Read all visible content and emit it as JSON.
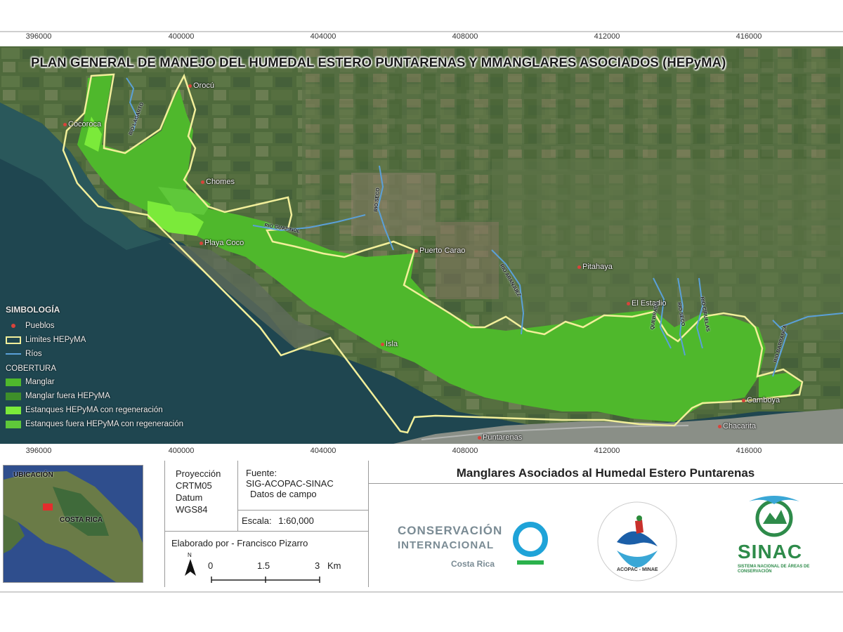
{
  "title": "PLAN GENERAL DE MANEJO DEL HUMEDAL ESTERO PUNTARENAS Y MMANGLARES ASOCIADOS (HEPyMA)",
  "coordinates": {
    "top": [
      "396000",
      "400000",
      "404000",
      "408000",
      "412000",
      "416000"
    ],
    "bottom": [
      "396000",
      "400000",
      "404000",
      "408000",
      "412000",
      "416000"
    ]
  },
  "places": [
    {
      "name": "Orocú"
    },
    {
      "name": "Cocoroca"
    },
    {
      "name": "Chomes"
    },
    {
      "name": "Playa Coco"
    },
    {
      "name": "Puerto Carao"
    },
    {
      "name": "Pitahaya"
    },
    {
      "name": "El Estadio"
    },
    {
      "name": "Isla"
    },
    {
      "name": "Camboya"
    },
    {
      "name": "Chacarita"
    },
    {
      "name": "Puntarenas"
    }
  ],
  "rivers": [
    "RIO LAGARTO",
    "RIO GUAPINOL",
    "RIO SECO",
    "RIO ARANJUEZ",
    "QUEBRADA",
    "RIO SECO",
    "RIO CIRUELAS",
    "RIO BARRANCA"
  ],
  "legend": {
    "title": "SIMBOLOGÍA",
    "items": [
      {
        "label": "Pueblos",
        "icon": "town-dot-icon",
        "color": "#d9433b"
      },
      {
        "label": "Limites HEPyMA",
        "icon": "boundary-line-icon",
        "color": "#f2ef9a"
      },
      {
        "label": "Ríos",
        "icon": "river-line-icon",
        "color": "#5aa0d8"
      }
    ],
    "cover_title": "COBERTURA",
    "cover_items": [
      {
        "label": "Manglar",
        "color": "#4fb82c"
      },
      {
        "label": "Manglar fuera HEPyMA",
        "color": "#3e8f2a"
      },
      {
        "label": "Estanques HEPyMA con regeneración",
        "color": "#7bea3a"
      },
      {
        "label": "Estanques fuera HEPyMA con regeneración",
        "color": "#5fc83a"
      }
    ]
  },
  "inset": {
    "label_location": "UBICACIÓN",
    "label_country": "COSTA RICA"
  },
  "projection": {
    "line1": "Proyección",
    "line2": "CRTM05",
    "line3": "Datum",
    "line4": "WGS84"
  },
  "source": {
    "title": "Fuente:",
    "line1": "SIG-ACOPAC-SINAC",
    "line2": "Datos de campo"
  },
  "scale": {
    "label": "Escala:",
    "value": "1:60,000",
    "ticks": [
      "0",
      "1.5",
      "3"
    ],
    "unit": "Km",
    "north": "N"
  },
  "author": "Elaborado por - Francisco Pizarro",
  "subtitle": "Manglares Asociados al Humedal Estero Puntarenas",
  "logos": {
    "ci_line1": "CONSERVACIÓN",
    "ci_line2": "INTERNACIONAL",
    "ci_line3": "Costa Rica",
    "acopac_text": "ACOPAC - MINAE",
    "sinac": "SINAC",
    "sinac_sub": "SISTEMA NACIONAL DE ÁREAS DE CONSERVACIÓN"
  },
  "colors": {
    "mangrove": "#4fb82c",
    "boundary": "#f2ef9a",
    "river": "#5aa0d8",
    "sea": "#1f4650",
    "land": "#4d6b3e"
  }
}
